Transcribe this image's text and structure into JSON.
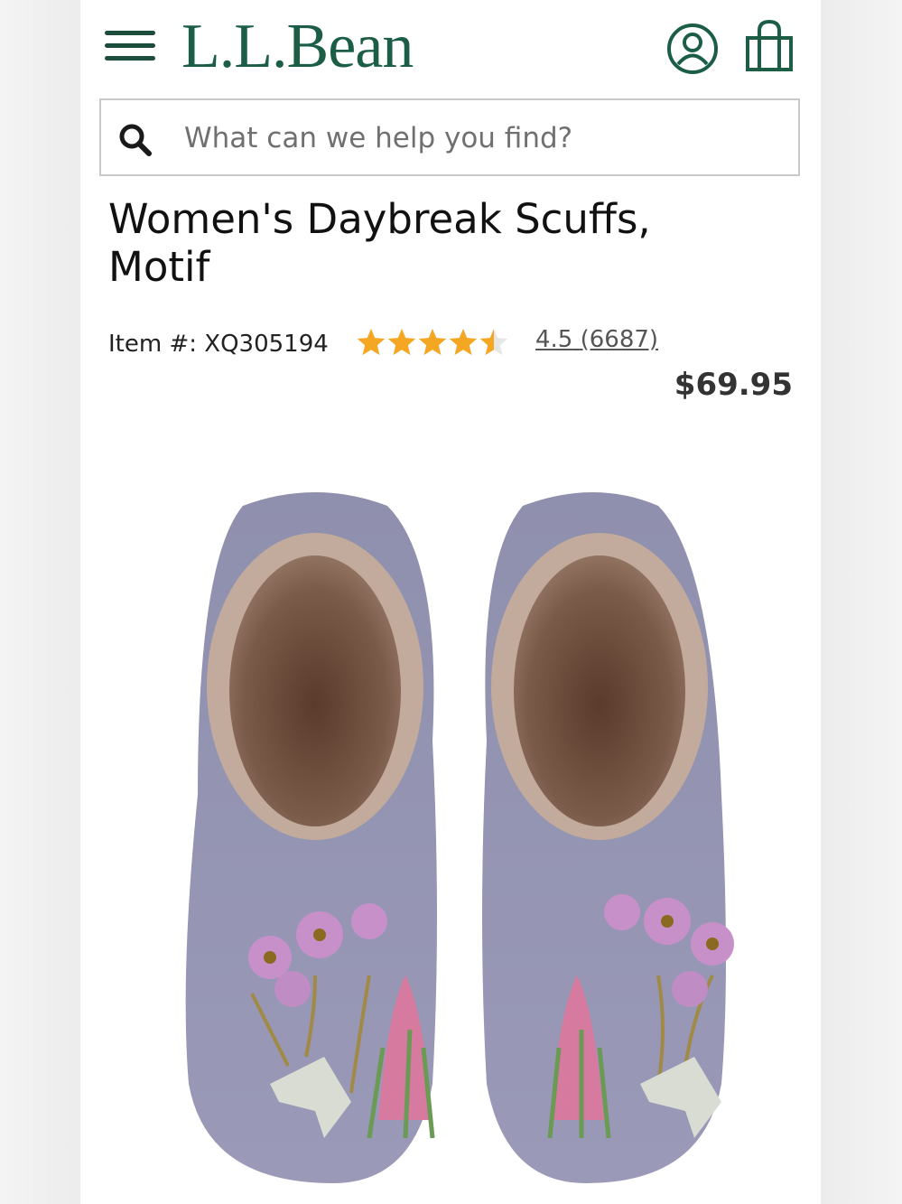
{
  "header": {
    "logo_text": "L.L.Bean",
    "brand_color": "#1b5e45",
    "icons": [
      "hamburger-menu-icon",
      "account-icon",
      "shopping-bag-icon"
    ]
  },
  "search": {
    "placeholder": "What can we help you find?",
    "value": ""
  },
  "product": {
    "title": "Women's Daybreak Scuffs, Motif",
    "item_number": "Item #: XQ305194",
    "rating_value": "4.5",
    "review_count": "(6687)",
    "rating_fraction": 0.9,
    "star_color": "#f5a623",
    "price": "$69.95",
    "image": "purple-wool-slippers-with-floral-embroidery"
  }
}
